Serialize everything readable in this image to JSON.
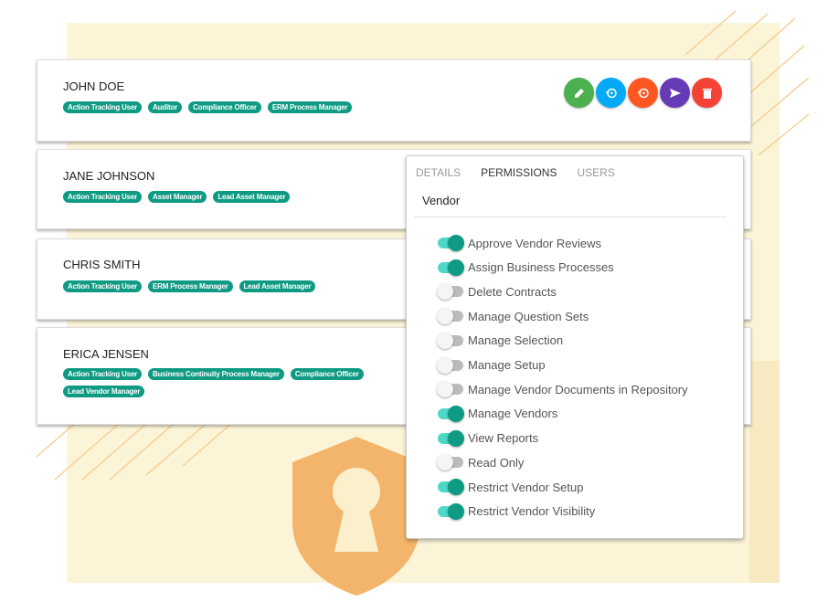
{
  "colors": {
    "accent": "#0f9a83",
    "edit": "#4caf50",
    "reset_blue": "#03a9f4",
    "reset_orange": "#ff5722",
    "send": "#673ab7",
    "delete": "#f44336"
  },
  "users": [
    {
      "name": "JOHN DOE",
      "roles": [
        "Action Tracking User",
        "Auditor",
        "Compliance Officer",
        "ERM Process Manager"
      ]
    },
    {
      "name": "JANE JOHNSON",
      "roles": [
        "Action Tracking User",
        "Asset Manager",
        "Lead Asset Manager"
      ]
    },
    {
      "name": "CHRIS SMITH",
      "roles": [
        "Action Tracking User",
        "ERM Process Manager",
        "Lead Asset Manager"
      ]
    },
    {
      "name": "ERICA JENSEN",
      "roles": [
        "Action Tracking User",
        "Business Continuity Process Manager",
        "Compliance Officer",
        "Lead Vendor Manager"
      ]
    }
  ],
  "actions": [
    {
      "icon": "pencil-icon",
      "color": "#4caf50"
    },
    {
      "icon": "reset-icon",
      "color": "#03a9f4"
    },
    {
      "icon": "reset-icon",
      "color": "#ff5722"
    },
    {
      "icon": "send-icon",
      "color": "#673ab7"
    },
    {
      "icon": "trash-icon",
      "color": "#f44336"
    }
  ],
  "popup": {
    "tabs": [
      "DETAILS",
      "PERMISSIONS",
      "USERS"
    ],
    "active_tab": "PERMISSIONS",
    "section": "Vendor",
    "permissions": [
      {
        "label": "Approve Vendor Reviews",
        "on": true
      },
      {
        "label": "Assign Business Processes",
        "on": true
      },
      {
        "label": "Delete Contracts",
        "on": false
      },
      {
        "label": "Manage Question Sets",
        "on": false
      },
      {
        "label": "Manage Selection",
        "on": false
      },
      {
        "label": "Manage Setup",
        "on": false
      },
      {
        "label": "Manage Vendor Documents in Repository",
        "on": false
      },
      {
        "label": "Manage Vendors",
        "on": true
      },
      {
        "label": "View Reports",
        "on": true
      },
      {
        "label": "Read Only",
        "on": false
      },
      {
        "label": "Restrict Vendor Setup",
        "on": true
      },
      {
        "label": "Restrict Vendor Visibility",
        "on": true
      }
    ]
  }
}
